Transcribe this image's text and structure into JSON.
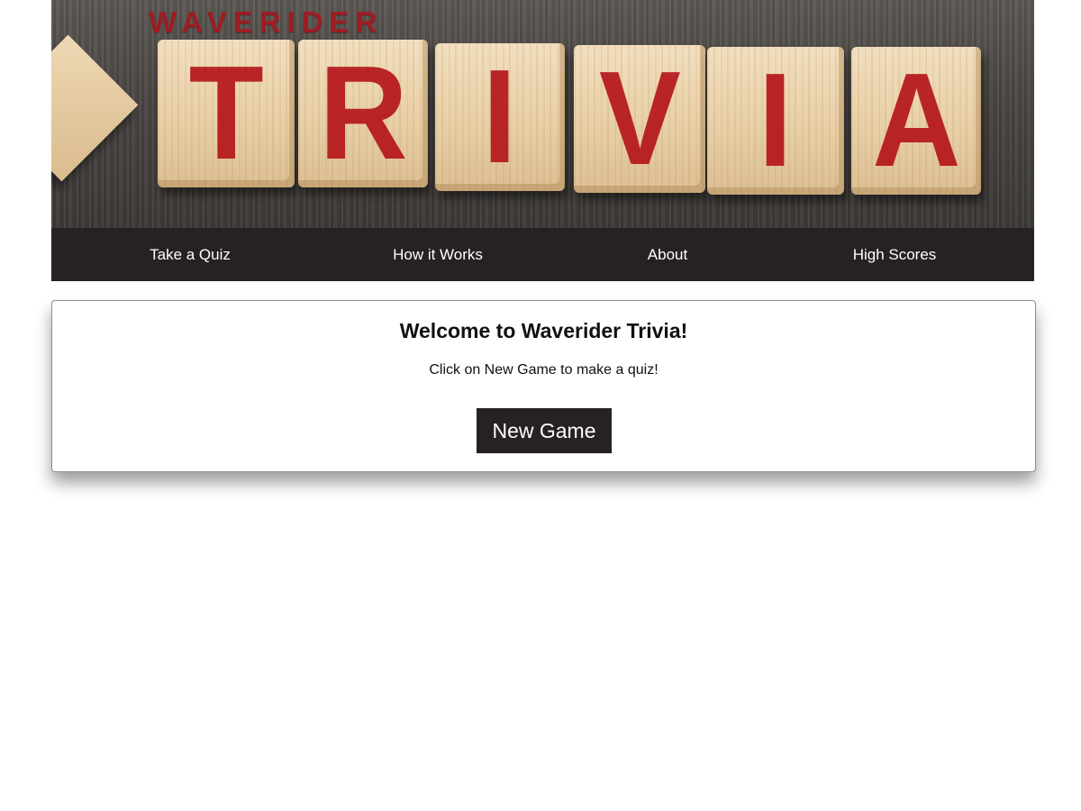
{
  "banner": {
    "brand": "WAVERIDER",
    "letters": [
      "T",
      "R",
      "I",
      "V",
      "I",
      "A"
    ],
    "letter_color": "#b5161c",
    "brand_color": "#9c1d22"
  },
  "nav": {
    "items": [
      {
        "label": "Take a Quiz"
      },
      {
        "label": "How it Works"
      },
      {
        "label": "About"
      },
      {
        "label": "High Scores"
      }
    ],
    "background": "#262122"
  },
  "welcome": {
    "title": "Welcome to Waverider Trivia!",
    "text": "Click on New Game to make a quiz!",
    "button_label": "New Game"
  }
}
